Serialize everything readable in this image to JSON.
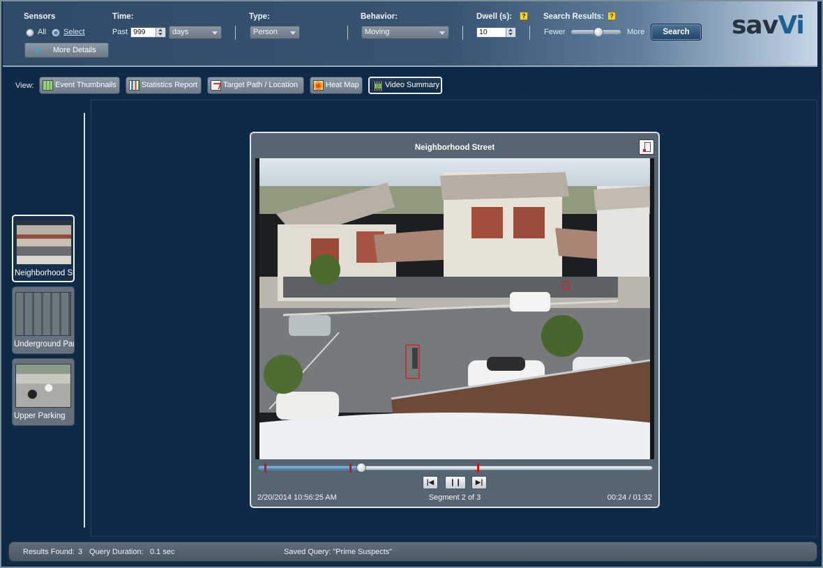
{
  "search": {
    "sensors": {
      "label": "Sensors",
      "all_label": "All",
      "select_label": "Select",
      "selected": "Select"
    },
    "time": {
      "label": "Time:",
      "past_label": "Past",
      "value": "999",
      "unit": "days"
    },
    "type": {
      "label": "Type:",
      "value": "Person"
    },
    "behavior": {
      "label": "Behavior:",
      "value": "Moving"
    },
    "dwell": {
      "label": "Dwell (s):",
      "value": "10"
    },
    "results": {
      "label": "Search Results:",
      "fewer_label": "Fewer",
      "more_label": "More",
      "level": 0.55
    },
    "search_button": "Search",
    "more_details_button": "More Details",
    "help_glyph": "?"
  },
  "brand": {
    "logo_text_a": "sav",
    "logo_text_b": "Vi"
  },
  "views": {
    "label": "View:",
    "buttons": [
      {
        "label": "Event Thumbnails",
        "icon": "grid-icon"
      },
      {
        "label": "Statistics Report",
        "icon": "bar-chart-icon"
      },
      {
        "label": "Target Path / Location",
        "icon": "path-icon"
      },
      {
        "label": "Heat Map",
        "icon": "heat-map-icon"
      },
      {
        "label": "Video Summary",
        "icon": "film-icon",
        "active": true
      }
    ]
  },
  "sensors_list": [
    {
      "label": "Neighborhood Street",
      "active": true
    },
    {
      "label": "Underground Parking",
      "active": false
    },
    {
      "label": "Upper Parking",
      "active": false
    }
  ],
  "player": {
    "title": "Neighborhood Street",
    "timestamp": "2/20/2014 10:56:25 AM",
    "segment": "Segment 2 of 3",
    "time": "00:24 / 01:32",
    "progress": 0.26,
    "segment_marks": [
      0.015,
      0.23,
      0.555
    ],
    "controls": {
      "prev": "previous-segment",
      "pause": "pause",
      "next": "next-segment"
    }
  },
  "status": {
    "results_label": "Results Found:",
    "results_value": "3",
    "duration_label": "Query Duration:",
    "duration_value": "0.1 sec",
    "saved_query": "Saved Query: \"Prime Suspects\""
  },
  "colors": {
    "background": "#0e2a47",
    "accent": "#3e7cb8",
    "marker": "#d61010"
  }
}
